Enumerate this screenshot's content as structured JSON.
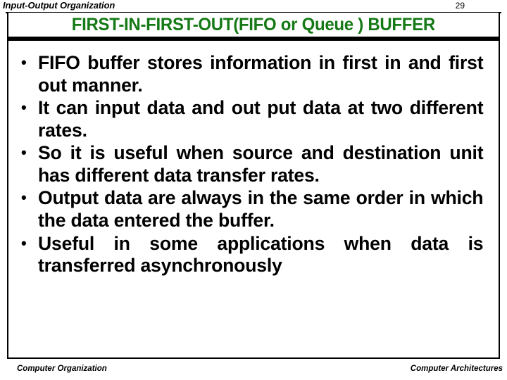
{
  "header": {
    "title": "Input-Output Organization",
    "page_number": "29"
  },
  "title_box": {
    "title": "FIRST-IN-FIRST-OUT(FIFO or Queue )  BUFFER",
    "title_color": "#157a15"
  },
  "content": {
    "bullets": [
      "FIFO buffer stores information in first in and first out manner.",
      " It can input data and out put data at two different rates.",
      "So it is useful when source and destination unit has different data transfer rates.",
      "Output data are always in the same order in which the data entered the buffer.",
      "Useful in some applications when data is transferred asynchronously"
    ]
  },
  "footer": {
    "left": "Computer Organization",
    "right": "Computer Architectures"
  }
}
